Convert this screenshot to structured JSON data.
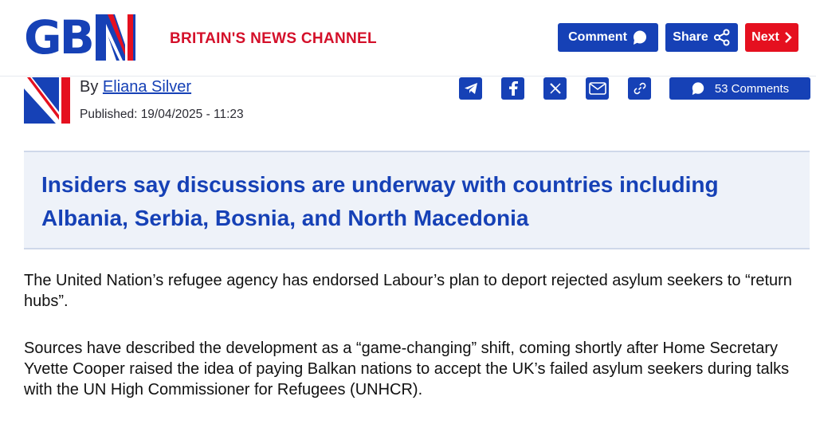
{
  "header": {
    "logo_text": "GB",
    "tagline": "BRITAIN'S NEWS CHANNEL",
    "comment_label": "Comment",
    "share_label": "Share",
    "next_label": "Next",
    "brand_blue": "#1641b6",
    "brand_red": "#e5101f"
  },
  "article": {
    "by_prefix": "By",
    "author": "Eliana Silver",
    "published": "Published: 19/04/2025 - 11:23",
    "share_icons": [
      "telegram-icon",
      "facebook-icon",
      "x-icon",
      "email-icon",
      "link-icon"
    ],
    "comments_label": "53 Comments",
    "standfirst": "Insiders say discussions are underway with countries including Albania, Serbia, Bosnia, and North Macedonia",
    "paragraphs": [
      "The United Nation’s refugee agency has endorsed Labour’s plan to deport rejected asylum seekers to “return hubs”.",
      "Sources have described the development as a “game-changing” shift, coming shortly after Home Secretary Yvette Cooper raised the idea of paying Balkan nations to accept the UK’s failed asylum seekers during talks with the UN High Commissioner for Refugees (UNHCR)."
    ]
  }
}
